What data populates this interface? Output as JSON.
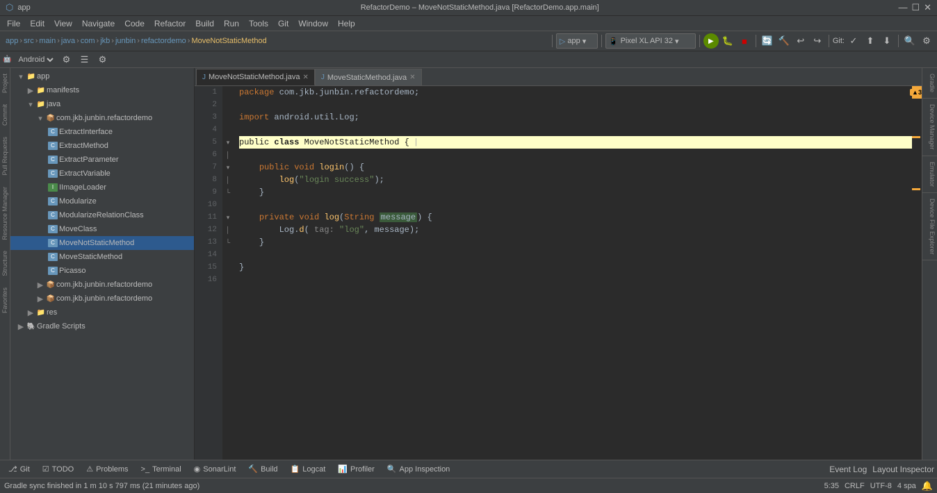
{
  "titleBar": {
    "title": "RefactorDemo – MoveNotStaticMethod.java [RefactorDemo.app.main]",
    "controls": [
      "—",
      "☐",
      "✕"
    ]
  },
  "menuBar": {
    "items": [
      "File",
      "Edit",
      "View",
      "Navigate",
      "Code",
      "Refactor",
      "Build",
      "Run",
      "Tools",
      "Git",
      "Window",
      "Help"
    ]
  },
  "toolbar": {
    "breadcrumb": [
      "app",
      "src",
      "main",
      "java",
      "com",
      "jkb",
      "junbin",
      "refactordemo",
      "MoveNotStaticMethod"
    ],
    "appDropdown": "app",
    "deviceDropdown": "Pixel XL API 32",
    "gitLabel": "Git:"
  },
  "navBar": {
    "parts": [
      "app",
      "src",
      "main",
      "java",
      "com",
      "jkb",
      "junbin",
      "refactordemo",
      "MoveNotStaticMethod"
    ]
  },
  "projectPanel": {
    "title": "Project",
    "androidLabel": "Android",
    "items": [
      {
        "id": "app",
        "label": "app",
        "level": 1,
        "type": "folder",
        "expanded": true
      },
      {
        "id": "manifests",
        "label": "manifests",
        "level": 2,
        "type": "folder",
        "expanded": false
      },
      {
        "id": "java",
        "label": "java",
        "level": 2,
        "type": "folder",
        "expanded": true
      },
      {
        "id": "com.jkb.junbin.refactordemo",
        "label": "com.jkb.junbin.refactordemo",
        "level": 3,
        "type": "package",
        "expanded": true
      },
      {
        "id": "ExtractInterface",
        "label": "ExtractInterface",
        "level": 4,
        "type": "class"
      },
      {
        "id": "ExtractMethod",
        "label": "ExtractMethod",
        "level": 4,
        "type": "class"
      },
      {
        "id": "ExtractParameter",
        "label": "ExtractParameter",
        "level": 4,
        "type": "class"
      },
      {
        "id": "ExtractVariable",
        "label": "ExtractVariable",
        "level": 4,
        "type": "class"
      },
      {
        "id": "IImageLoader",
        "label": "IImageLoader",
        "level": 4,
        "type": "interface"
      },
      {
        "id": "Modularize",
        "label": "Modularize",
        "level": 4,
        "type": "class"
      },
      {
        "id": "ModularizeRelationClass",
        "label": "ModularizeRelationClass",
        "level": 4,
        "type": "class"
      },
      {
        "id": "MoveClass",
        "label": "MoveClass",
        "level": 4,
        "type": "class"
      },
      {
        "id": "MoveNotStaticMethod",
        "label": "MoveNotStaticMethod",
        "level": 4,
        "type": "class",
        "active": true
      },
      {
        "id": "MoveStaticMethod",
        "label": "MoveStaticMethod",
        "level": 4,
        "type": "class"
      },
      {
        "id": "Picasso",
        "label": "Picasso",
        "level": 4,
        "type": "class"
      },
      {
        "id": "pkg2",
        "label": "com.jkb.junbin.refactordemo",
        "level": 3,
        "type": "package",
        "expanded": false
      },
      {
        "id": "pkg3",
        "label": "com.jkb.junbin.refactordemo",
        "level": 3,
        "type": "package",
        "expanded": false
      },
      {
        "id": "res",
        "label": "res",
        "level": 2,
        "type": "folder",
        "expanded": false
      },
      {
        "id": "gradleScripts",
        "label": "Gradle Scripts",
        "level": 1,
        "type": "gradle",
        "expanded": false
      }
    ]
  },
  "tabs": [
    {
      "label": "MoveNotStaticMethod.java",
      "active": true,
      "icon": "J"
    },
    {
      "label": "MoveStaticMethod.java",
      "active": false,
      "icon": "J"
    }
  ],
  "codeLines": [
    {
      "num": 1,
      "tokens": [
        {
          "t": "package com.jkb.junbin.refactordemo;",
          "c": "default"
        }
      ],
      "highlight": false,
      "foldable": false
    },
    {
      "num": 2,
      "tokens": [],
      "highlight": false,
      "foldable": false
    },
    {
      "num": 3,
      "tokens": [
        {
          "t": "import android.util.Log;",
          "c": "default"
        }
      ],
      "highlight": false,
      "foldable": false
    },
    {
      "num": 4,
      "tokens": [],
      "highlight": false,
      "foldable": false
    },
    {
      "num": 5,
      "tokens": [
        {
          "t": "public class MoveNotStaticMethod {",
          "c": "class-decl"
        }
      ],
      "highlight": true,
      "foldable": false
    },
    {
      "num": 6,
      "tokens": [],
      "highlight": false,
      "foldable": true
    },
    {
      "num": 7,
      "tokens": [
        {
          "t": "    public void login() {",
          "c": "method"
        }
      ],
      "highlight": false,
      "foldable": false
    },
    {
      "num": 8,
      "tokens": [
        {
          "t": "        log(\"login success\");",
          "c": "call"
        }
      ],
      "highlight": false,
      "foldable": false
    },
    {
      "num": 9,
      "tokens": [
        {
          "t": "    }",
          "c": "punct"
        }
      ],
      "highlight": false,
      "foldable": false
    },
    {
      "num": 10,
      "tokens": [],
      "highlight": false,
      "foldable": false
    },
    {
      "num": 11,
      "tokens": [
        {
          "t": "    private void log(String message) {",
          "c": "method"
        }
      ],
      "highlight": false,
      "foldable": false
    },
    {
      "num": 12,
      "tokens": [
        {
          "t": "        Log.d( tag: \"log\", message);",
          "c": "call"
        }
      ],
      "highlight": false,
      "foldable": false
    },
    {
      "num": 13,
      "tokens": [
        {
          "t": "    }",
          "c": "punct"
        }
      ],
      "highlight": false,
      "foldable": false
    },
    {
      "num": 14,
      "tokens": [],
      "highlight": false,
      "foldable": false
    },
    {
      "num": 15,
      "tokens": [
        {
          "t": "}",
          "c": "punct"
        }
      ],
      "highlight": false,
      "foldable": false
    },
    {
      "num": 16,
      "tokens": [],
      "highlight": false,
      "foldable": false
    }
  ],
  "bottomTabs": [
    {
      "label": "Git",
      "icon": "⎇"
    },
    {
      "label": "TODO",
      "icon": "☑"
    },
    {
      "label": "Problems",
      "icon": "⚠"
    },
    {
      "label": "Terminal",
      "icon": ">_"
    },
    {
      "label": "SonarLint",
      "icon": "◉"
    },
    {
      "label": "Build",
      "icon": "🔨"
    },
    {
      "label": "Logcat",
      "icon": "📋"
    },
    {
      "label": "Profiler",
      "icon": "📊"
    },
    {
      "label": "App Inspection",
      "icon": "🔍"
    }
  ],
  "statusBar": {
    "message": "Gradle sync finished in 1 m 10 s 797 ms (21 minutes ago)",
    "cursor": "5:35",
    "encoding": "CRLF",
    "charset": "UTF-8",
    "indent": "4 spa",
    "eventLog": "Event Log",
    "layoutInspector": "Layout Inspector"
  },
  "rightTabs": [
    "Gradle",
    "Device Manager",
    "Emulator",
    "Device File Explorer"
  ],
  "warningBadge": "▲3"
}
